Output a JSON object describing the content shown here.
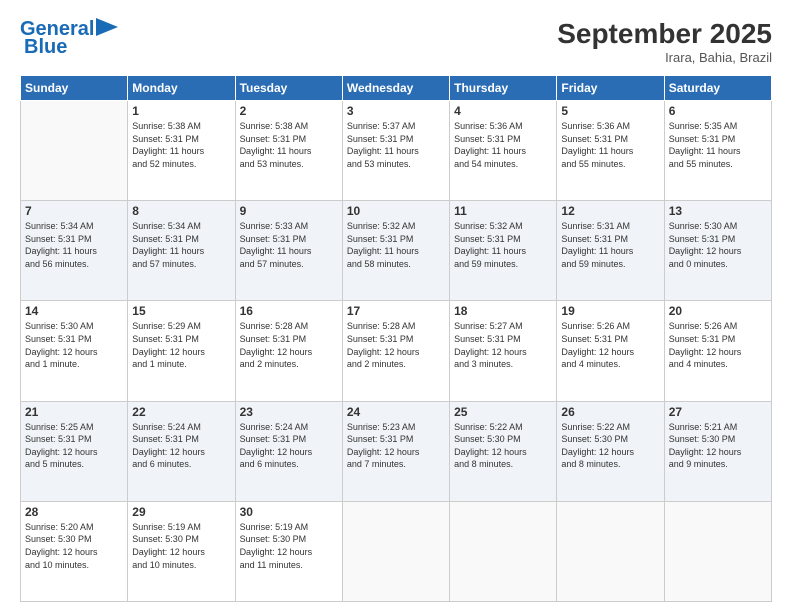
{
  "header": {
    "logo_line1": "General",
    "logo_line2": "Blue",
    "month": "September 2025",
    "location": "Irara, Bahia, Brazil"
  },
  "weekdays": [
    "Sunday",
    "Monday",
    "Tuesday",
    "Wednesday",
    "Thursday",
    "Friday",
    "Saturday"
  ],
  "weeks": [
    [
      {
        "day": "",
        "info": ""
      },
      {
        "day": "1",
        "info": "Sunrise: 5:38 AM\nSunset: 5:31 PM\nDaylight: 11 hours\nand 52 minutes."
      },
      {
        "day": "2",
        "info": "Sunrise: 5:38 AM\nSunset: 5:31 PM\nDaylight: 11 hours\nand 53 minutes."
      },
      {
        "day": "3",
        "info": "Sunrise: 5:37 AM\nSunset: 5:31 PM\nDaylight: 11 hours\nand 53 minutes."
      },
      {
        "day": "4",
        "info": "Sunrise: 5:36 AM\nSunset: 5:31 PM\nDaylight: 11 hours\nand 54 minutes."
      },
      {
        "day": "5",
        "info": "Sunrise: 5:36 AM\nSunset: 5:31 PM\nDaylight: 11 hours\nand 55 minutes."
      },
      {
        "day": "6",
        "info": "Sunrise: 5:35 AM\nSunset: 5:31 PM\nDaylight: 11 hours\nand 55 minutes."
      }
    ],
    [
      {
        "day": "7",
        "info": "Sunrise: 5:34 AM\nSunset: 5:31 PM\nDaylight: 11 hours\nand 56 minutes."
      },
      {
        "day": "8",
        "info": "Sunrise: 5:34 AM\nSunset: 5:31 PM\nDaylight: 11 hours\nand 57 minutes."
      },
      {
        "day": "9",
        "info": "Sunrise: 5:33 AM\nSunset: 5:31 PM\nDaylight: 11 hours\nand 57 minutes."
      },
      {
        "day": "10",
        "info": "Sunrise: 5:32 AM\nSunset: 5:31 PM\nDaylight: 11 hours\nand 58 minutes."
      },
      {
        "day": "11",
        "info": "Sunrise: 5:32 AM\nSunset: 5:31 PM\nDaylight: 11 hours\nand 59 minutes."
      },
      {
        "day": "12",
        "info": "Sunrise: 5:31 AM\nSunset: 5:31 PM\nDaylight: 11 hours\nand 59 minutes."
      },
      {
        "day": "13",
        "info": "Sunrise: 5:30 AM\nSunset: 5:31 PM\nDaylight: 12 hours\nand 0 minutes."
      }
    ],
    [
      {
        "day": "14",
        "info": "Sunrise: 5:30 AM\nSunset: 5:31 PM\nDaylight: 12 hours\nand 1 minute."
      },
      {
        "day": "15",
        "info": "Sunrise: 5:29 AM\nSunset: 5:31 PM\nDaylight: 12 hours\nand 1 minute."
      },
      {
        "day": "16",
        "info": "Sunrise: 5:28 AM\nSunset: 5:31 PM\nDaylight: 12 hours\nand 2 minutes."
      },
      {
        "day": "17",
        "info": "Sunrise: 5:28 AM\nSunset: 5:31 PM\nDaylight: 12 hours\nand 2 minutes."
      },
      {
        "day": "18",
        "info": "Sunrise: 5:27 AM\nSunset: 5:31 PM\nDaylight: 12 hours\nand 3 minutes."
      },
      {
        "day": "19",
        "info": "Sunrise: 5:26 AM\nSunset: 5:31 PM\nDaylight: 12 hours\nand 4 minutes."
      },
      {
        "day": "20",
        "info": "Sunrise: 5:26 AM\nSunset: 5:31 PM\nDaylight: 12 hours\nand 4 minutes."
      }
    ],
    [
      {
        "day": "21",
        "info": "Sunrise: 5:25 AM\nSunset: 5:31 PM\nDaylight: 12 hours\nand 5 minutes."
      },
      {
        "day": "22",
        "info": "Sunrise: 5:24 AM\nSunset: 5:31 PM\nDaylight: 12 hours\nand 6 minutes."
      },
      {
        "day": "23",
        "info": "Sunrise: 5:24 AM\nSunset: 5:31 PM\nDaylight: 12 hours\nand 6 minutes."
      },
      {
        "day": "24",
        "info": "Sunrise: 5:23 AM\nSunset: 5:31 PM\nDaylight: 12 hours\nand 7 minutes."
      },
      {
        "day": "25",
        "info": "Sunrise: 5:22 AM\nSunset: 5:30 PM\nDaylight: 12 hours\nand 8 minutes."
      },
      {
        "day": "26",
        "info": "Sunrise: 5:22 AM\nSunset: 5:30 PM\nDaylight: 12 hours\nand 8 minutes."
      },
      {
        "day": "27",
        "info": "Sunrise: 5:21 AM\nSunset: 5:30 PM\nDaylight: 12 hours\nand 9 minutes."
      }
    ],
    [
      {
        "day": "28",
        "info": "Sunrise: 5:20 AM\nSunset: 5:30 PM\nDaylight: 12 hours\nand 10 minutes."
      },
      {
        "day": "29",
        "info": "Sunrise: 5:19 AM\nSunset: 5:30 PM\nDaylight: 12 hours\nand 10 minutes."
      },
      {
        "day": "30",
        "info": "Sunrise: 5:19 AM\nSunset: 5:30 PM\nDaylight: 12 hours\nand 11 minutes."
      },
      {
        "day": "",
        "info": ""
      },
      {
        "day": "",
        "info": ""
      },
      {
        "day": "",
        "info": ""
      },
      {
        "day": "",
        "info": ""
      }
    ]
  ]
}
